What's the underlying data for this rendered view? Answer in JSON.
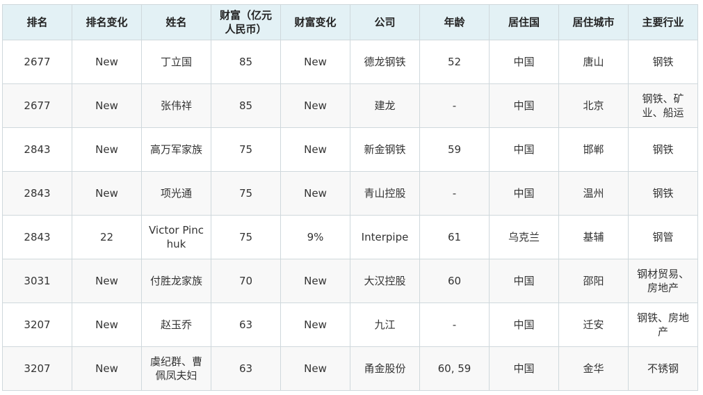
{
  "table": {
    "headers": [
      "排名",
      "排名变化",
      "姓名",
      "财富（亿元人民币）",
      "财富变化",
      "公司",
      "年龄",
      "居住国",
      "居住城市",
      "主要行业"
    ],
    "rows": [
      [
        "2677",
        "New",
        "丁立国",
        "85",
        "New",
        "德龙钢铁",
        "52",
        "中国",
        "唐山",
        "钢铁"
      ],
      [
        "2677",
        "New",
        "张伟祥",
        "85",
        "New",
        "建龙",
        "-",
        "中国",
        "北京",
        "钢铁、矿业、船运"
      ],
      [
        "2843",
        "New",
        "高万军家族",
        "75",
        "New",
        "新金钢铁",
        "59",
        "中国",
        "邯郸",
        "钢铁"
      ],
      [
        "2843",
        "New",
        "项光通",
        "75",
        "New",
        "青山控股",
        "-",
        "中国",
        "温州",
        "钢铁"
      ],
      [
        "2843",
        "22",
        "Victor Pinchuk",
        "75",
        "9%",
        "Interpipe",
        "61",
        "乌克兰",
        "基辅",
        "钢管"
      ],
      [
        "3031",
        "New",
        "付胜龙家族",
        "70",
        "New",
        "大汉控股",
        "60",
        "中国",
        "邵阳",
        "钢材贸易、房地产"
      ],
      [
        "3207",
        "New",
        "赵玉乔",
        "63",
        "New",
        "九江",
        "-",
        "中国",
        "迁安",
        "钢铁、房地产"
      ],
      [
        "3207",
        "New",
        "虞纪群、曹佩凤夫妇",
        "63",
        "New",
        "甬金股份",
        "60, 59",
        "中国",
        "金华",
        "不锈钢"
      ]
    ]
  }
}
